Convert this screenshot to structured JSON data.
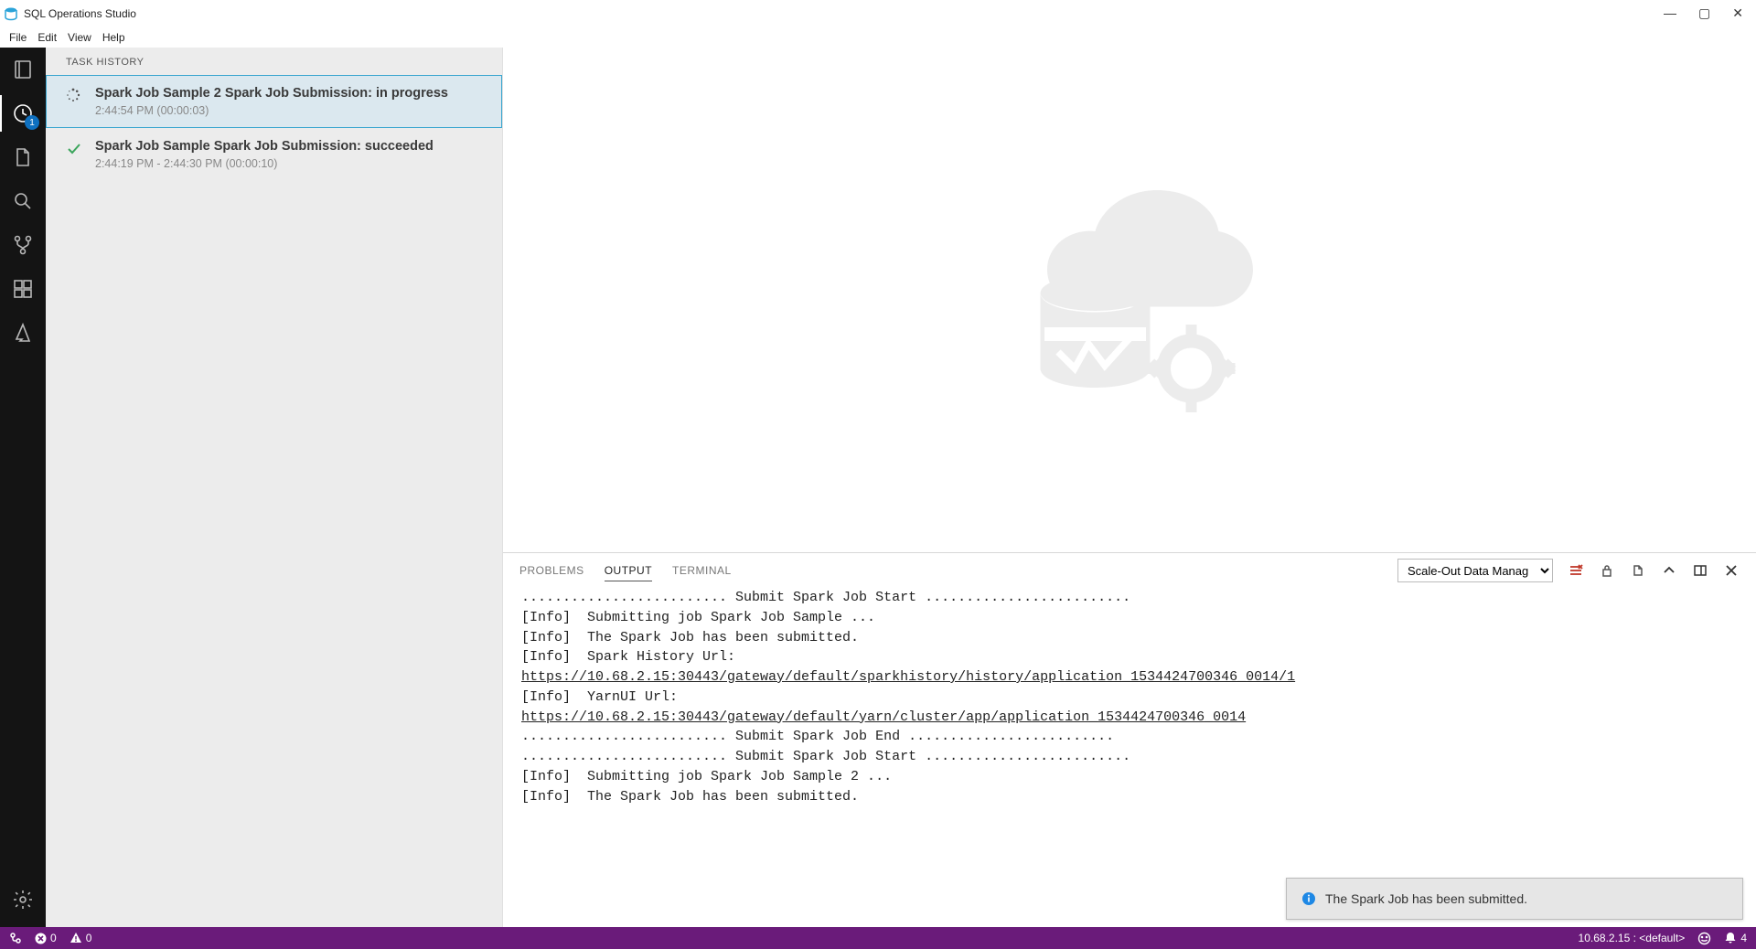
{
  "window": {
    "title": "SQL Operations Studio"
  },
  "menu": {
    "file": "File",
    "edit": "Edit",
    "view": "View",
    "help": "Help"
  },
  "activity": {
    "history_badge": "1"
  },
  "sidebar": {
    "header": "TASK HISTORY",
    "tasks": [
      {
        "status": "progress",
        "title": "Spark Job Sample 2 Spark Job Submission: in progress",
        "sub": "2:44:54 PM (00:00:03)"
      },
      {
        "status": "success",
        "title": "Spark Job Sample Spark Job Submission: succeeded",
        "sub": "2:44:19 PM - 2:44:30 PM (00:00:10)"
      }
    ]
  },
  "panel": {
    "tabs": {
      "problems": "PROBLEMS",
      "output": "OUTPUT",
      "terminal": "TERMINAL"
    },
    "selected_channel": "Scale-Out Data Manag",
    "output_lines": [
      "......................... Submit Spark Job Start .........................",
      "[Info]  Submitting job Spark Job Sample ...",
      "[Info]  The Spark Job has been submitted.",
      "[Info]  Spark History Url:",
      {
        "link": "https://10.68.2.15:30443/gateway/default/sparkhistory/history/application_1534424700346_0014/1"
      },
      "[Info]  YarnUI Url:",
      {
        "link": "https://10.68.2.15:30443/gateway/default/yarn/cluster/app/application_1534424700346_0014"
      },
      "......................... Submit Spark Job End .........................",
      "......................... Submit Spark Job Start .........................",
      "[Info]  Submitting job Spark Job Sample 2 ...",
      "[Info]  The Spark Job has been submitted."
    ]
  },
  "status": {
    "errors": "0",
    "warnings": "0",
    "connection": "10.68.2.15 : <default>",
    "notifications": "4"
  },
  "toast": {
    "message": "The Spark Job has been submitted."
  }
}
